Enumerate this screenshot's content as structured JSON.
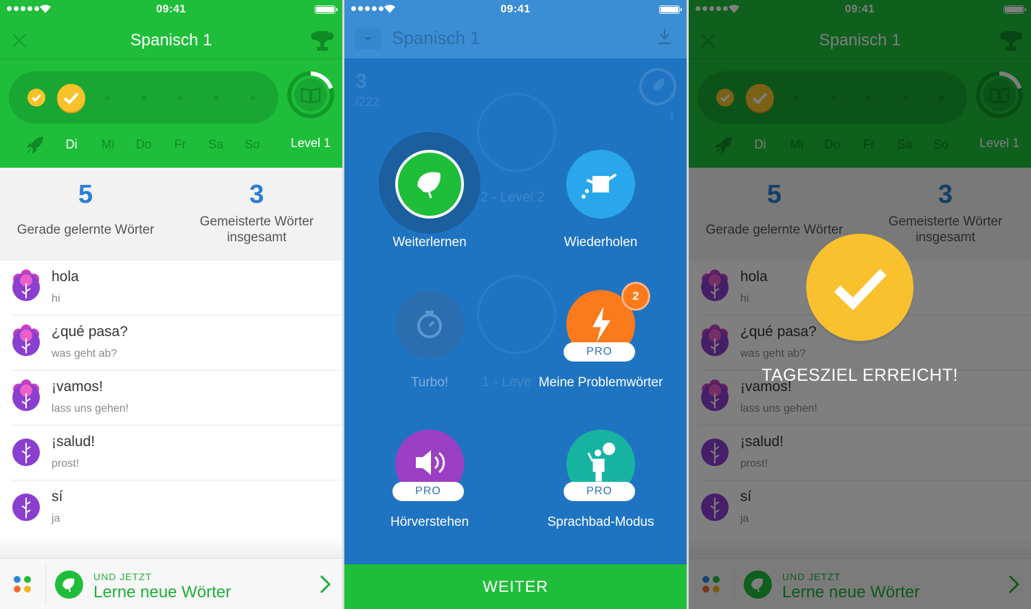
{
  "status": {
    "time": "09:41"
  },
  "course": {
    "title": "Spanisch 1"
  },
  "week": {
    "days": [
      "Di",
      "Mi",
      "Do",
      "Fr",
      "Sa",
      "So"
    ],
    "level_label": "Level 1",
    "level_progress": 0.2
  },
  "stats": {
    "learned_count": "5",
    "learned_label": "Gerade gelernte Wörter",
    "mastered_count": "3",
    "mastered_label_line1": "Gemeisterte Wörter",
    "mastered_label_line2": "insgesamt"
  },
  "words": [
    {
      "word": "hola",
      "translation": "hi",
      "stage": "bloom"
    },
    {
      "word": "¿qué pasa?",
      "translation": "was geht ab?",
      "stage": "bloom"
    },
    {
      "word": "¡vamos!",
      "translation": "lass uns gehen!",
      "stage": "bloom"
    },
    {
      "word": "¡salud!",
      "translation": "prost!",
      "stage": "sprout"
    },
    {
      "word": "sí",
      "translation": "ja",
      "stage": "sprout"
    }
  ],
  "bottom_bar": {
    "kicker": "UND JETZT",
    "title": "Lerne neue Wörter"
  },
  "modes_screen": {
    "bg_count": "3",
    "bg_total": "/222",
    "bg_one": "1",
    "bg_level2": "2 - Level 2",
    "bg_level1": "1 - Leve",
    "modes": [
      {
        "label": "Weiterlernen",
        "color": "#1fbe3a",
        "pro": ""
      },
      {
        "label": "Wiederholen",
        "color": "#2aa7ec",
        "pro": ""
      },
      {
        "label": "Turbo!",
        "color": "#2a6eb0",
        "pro": ""
      },
      {
        "label": "Meine Problemwörter",
        "color": "#fa7a1c",
        "pro": "PRO",
        "badge": "2"
      },
      {
        "label": "Hörverstehen",
        "color": "#9b3fc4",
        "pro": "PRO"
      },
      {
        "label": "Sprachbad-Modus",
        "color": "#17b3a1",
        "pro": "PRO"
      }
    ],
    "continue_label": "WEITER"
  },
  "goal": {
    "message": "TAGESZIEL ERREICHT!"
  },
  "colors": {
    "green": "#1fbe3a",
    "blue": "#1f74c2",
    "gold": "#f7c22a",
    "stat_blue": "#2a7fd5"
  }
}
